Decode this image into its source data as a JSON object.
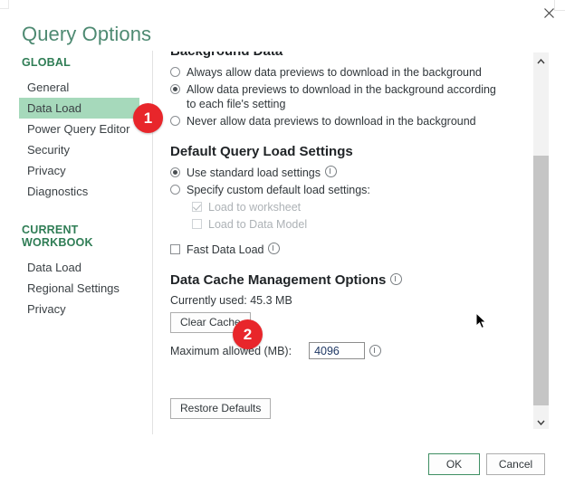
{
  "window": {
    "title": "Query Options",
    "close_icon": "close-icon"
  },
  "sidebar": {
    "groups": [
      {
        "title": "GLOBAL",
        "items": [
          {
            "label": "General",
            "selected": false
          },
          {
            "label": "Data Load",
            "selected": true
          },
          {
            "label": "Power Query Editor",
            "selected": false
          },
          {
            "label": "Security",
            "selected": false
          },
          {
            "label": "Privacy",
            "selected": false
          },
          {
            "label": "Diagnostics",
            "selected": false
          }
        ]
      },
      {
        "title": "CURRENT WORKBOOK",
        "items": [
          {
            "label": "Data Load",
            "selected": false
          },
          {
            "label": "Regional Settings",
            "selected": false
          },
          {
            "label": "Privacy",
            "selected": false
          }
        ]
      }
    ],
    "selected_highlight_color": "#a6d9bb",
    "group_title_color": "#2f7d55"
  },
  "content": {
    "background_data": {
      "heading": "Background Data",
      "options": [
        {
          "label": "Always allow data previews to download in the background",
          "checked": false
        },
        {
          "label": "Allow data previews to download in the background according to each file's setting",
          "checked": true
        },
        {
          "label": "Never allow data previews to download in the background",
          "checked": false
        }
      ]
    },
    "default_query_load_settings": {
      "heading": "Default Query Load Settings",
      "options": [
        {
          "label": "Use standard load settings",
          "checked": true,
          "info": true
        },
        {
          "label": "Specify custom default load settings:",
          "checked": false,
          "info": false
        }
      ],
      "sub_options": [
        {
          "label": "Load to worksheet",
          "checked": true,
          "disabled": true
        },
        {
          "label": "Load to Data Model",
          "checked": false,
          "disabled": true
        }
      ],
      "fast_data_load": {
        "label": "Fast Data Load",
        "checked": false,
        "info": true
      }
    },
    "data_cache": {
      "heading": "Data Cache Management Options",
      "heading_info": true,
      "currently_used": "Currently used: 45.3 MB",
      "clear_cache_label": "Clear Cache",
      "max_allowed_label": "Maximum allowed (MB):",
      "max_allowed_value": "4096",
      "max_allowed_info": true
    },
    "restore_defaults_label": "Restore Defaults"
  },
  "scrollbar": {
    "up_icon": "chevron-up-icon",
    "down_icon": "chevron-down-icon"
  },
  "footer": {
    "ok_label": "OK",
    "cancel_label": "Cancel",
    "ok_accent_color": "#3f8f63"
  },
  "annotations": [
    {
      "number": "1",
      "color": "#e8262b"
    },
    {
      "number": "2",
      "color": "#e8262b"
    }
  ]
}
